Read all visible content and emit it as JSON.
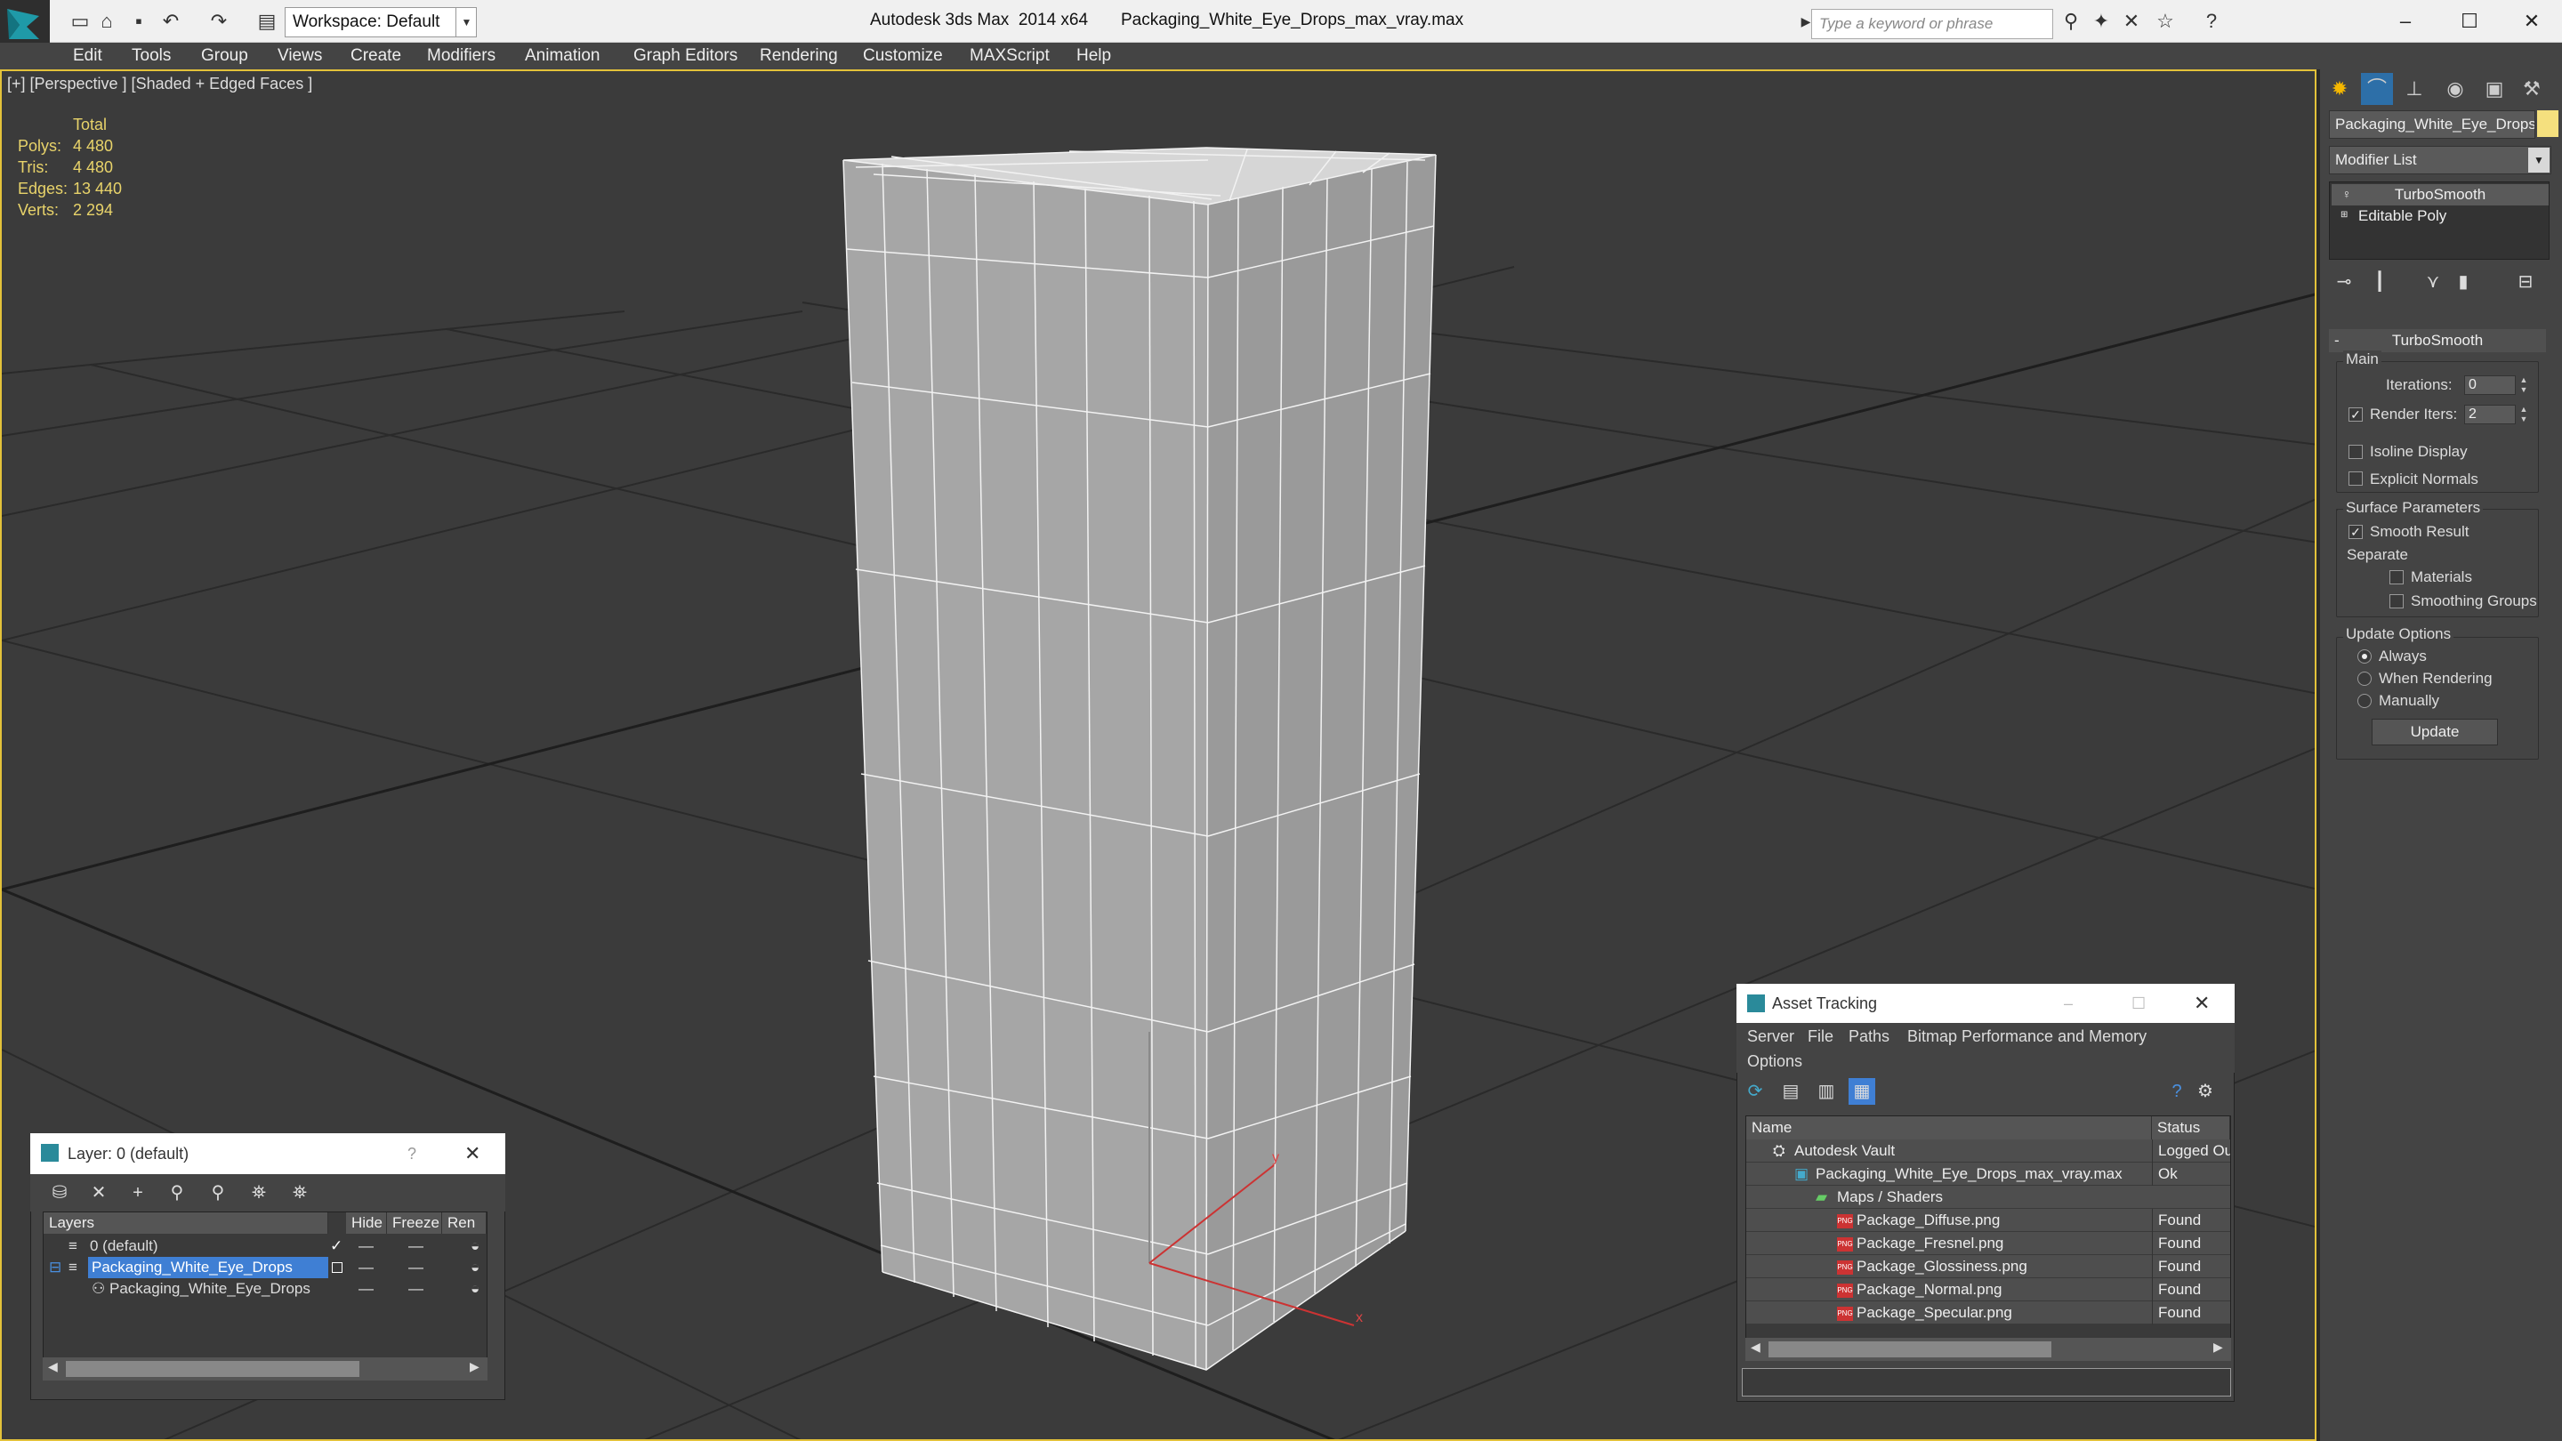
{
  "title_bar": {
    "app_title": "Autodesk 3ds Max  2014 x64",
    "file_name": "Packaging_White_Eye_Drops_max_vray.max",
    "workspace": "Workspace: Default",
    "search_placeholder": "Type a keyword or phrase"
  },
  "menu": [
    "Edit",
    "Tools",
    "Group",
    "Views",
    "Create",
    "Modifiers",
    "Animation",
    "Graph Editors",
    "Rendering",
    "Customize",
    "MAXScript",
    "Help"
  ],
  "viewport": {
    "label": "[+] [Perspective ] [Shaded + Edged Faces ]",
    "stats_header": "Total",
    "stats": [
      {
        "label": "Polys:",
        "value": "4 480"
      },
      {
        "label": "Tris:",
        "value": "4 480"
      },
      {
        "label": "Edges:",
        "value": "13 440"
      },
      {
        "label": "Verts:",
        "value": "2 294"
      }
    ],
    "axis_x": "x",
    "axis_y": "y"
  },
  "command_panel": {
    "object_name": "Packaging_White_Eye_Drops",
    "object_color": "#f5e07e",
    "modifier_list": "Modifier List",
    "stack": [
      "TurboSmooth",
      "Editable Poly"
    ],
    "rollout_title": "TurboSmooth",
    "main_group": "Main",
    "iterations_label": "Iterations:",
    "iterations_value": "0",
    "render_iters_label": "Render Iters:",
    "render_iters_value": "2",
    "render_iters_checked": true,
    "isoline_label": "Isoline Display",
    "explicit_normals_label": "Explicit Normals",
    "surface_group": "Surface Parameters",
    "smooth_result_label": "Smooth Result",
    "separate_label": "Separate",
    "materials_label": "Materials",
    "smoothing_groups_label": "Smoothing Groups",
    "update_group": "Update Options",
    "update_options": [
      "Always",
      "When Rendering",
      "Manually"
    ],
    "update_selected": "Always",
    "update_button": "Update"
  },
  "layer_window": {
    "title": "Layer: 0 (default)",
    "help": "?",
    "columns": [
      "Layers",
      "Hide",
      "Freeze",
      "Ren"
    ],
    "rows": [
      {
        "name": "0 (default)",
        "hide": "—",
        "freeze": "—"
      },
      {
        "name": "Packaging_White_Eye_Drops",
        "hide": "—",
        "freeze": "—"
      },
      {
        "name": "Packaging_White_Eye_Drops",
        "hide": "—",
        "freeze": "—"
      }
    ]
  },
  "asset_tracking": {
    "title": "Asset Tracking",
    "menu": [
      "Server",
      "File",
      "Paths",
      "Bitmap Performance and Memory",
      "Options"
    ],
    "columns": [
      "Name",
      "Status"
    ],
    "rows": [
      {
        "name": "Autodesk Vault",
        "status": "Logged Ou"
      },
      {
        "name": "Packaging_White_Eye_Drops_max_vray.max",
        "status": "Ok"
      },
      {
        "name": "Maps / Shaders",
        "status": ""
      },
      {
        "name": "Package_Diffuse.png",
        "status": "Found"
      },
      {
        "name": "Package_Fresnel.png",
        "status": "Found"
      },
      {
        "name": "Package_Glossiness.png",
        "status": "Found"
      },
      {
        "name": "Package_Normal.png",
        "status": "Found"
      },
      {
        "name": "Package_Specular.png",
        "status": "Found"
      }
    ]
  }
}
